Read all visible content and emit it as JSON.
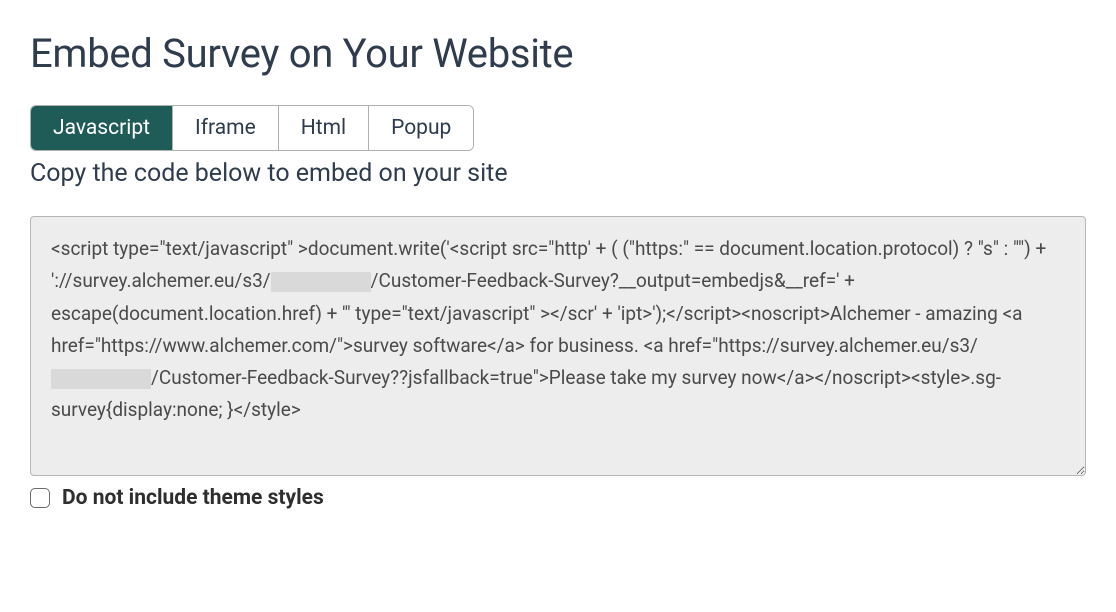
{
  "page": {
    "title": "Embed Survey on Your Website",
    "instruction": "Copy the code below to embed on your site"
  },
  "tabs": [
    {
      "label": "Javascript",
      "active": true
    },
    {
      "label": "Iframe",
      "active": false
    },
    {
      "label": "Html",
      "active": false
    },
    {
      "label": "Popup",
      "active": false
    }
  ],
  "code": {
    "prefix1": "<script type=\"text/javascript\" >document.write('<script src=\"http' + ( (\"https:\" == document.location.protocol) ? \"s\" : \"\") + '://survey.alchemer.eu/s3/",
    "mid1": "/Customer-Feedback-Survey?__output=embedjs&__ref=' + escape(document.location.href) + '\" type=\"text/javascript\" ></scr' + 'ipt>');</script><noscript>Alchemer - amazing <a href=\"https://www.alchemer.com/\">survey software</a> for business. <a href=\"https://survey.alchemer.eu/s3/",
    "suffix1": "/Customer-Feedback-Survey??jsfallback=true\">Please take my survey now</a></noscript><style>.sg-survey{display:none; }</style>"
  },
  "options": {
    "theme_label": "Do not include theme styles",
    "theme_checked": false
  }
}
